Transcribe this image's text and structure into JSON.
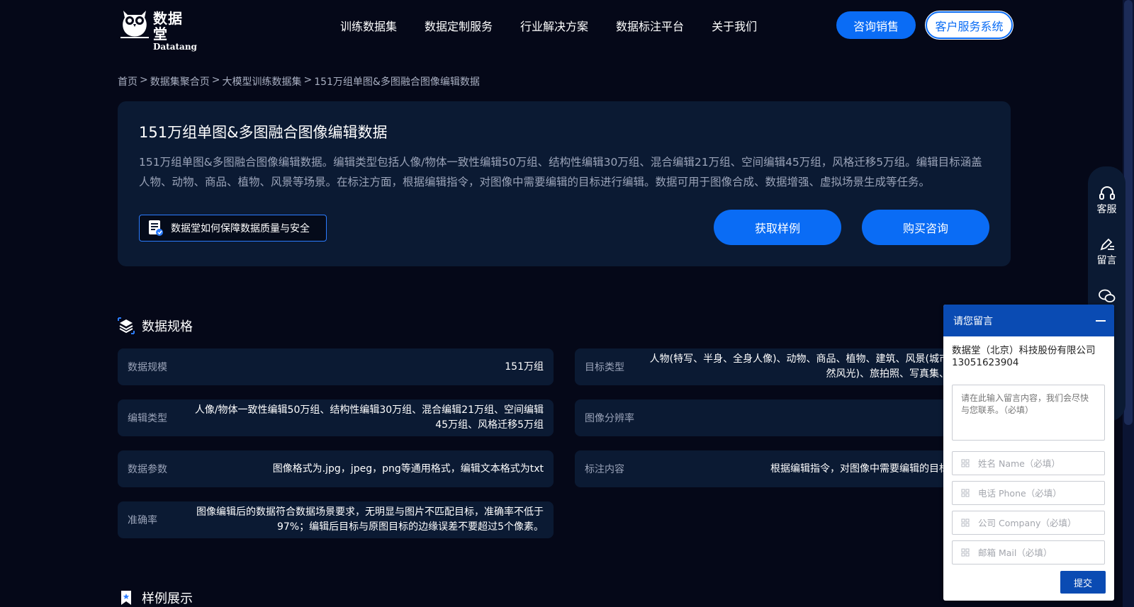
{
  "brand": {
    "name_cn": "数据堂",
    "name_en": "Datatang"
  },
  "nav": [
    "训练数据集",
    "数据定制服务",
    "行业解决方案",
    "数据标注平台",
    "关于我们"
  ],
  "header_buttons": {
    "sales": "咨询销售",
    "service": "客户服务系统"
  },
  "breadcrumb": [
    "首页",
    "数据集聚合页",
    "大模型训练数据集",
    "151万组单图&多图融合图像编辑数据"
  ],
  "breadcrumb_sep": ">",
  "hero": {
    "title": "151万组单图&多图融合图像编辑数据",
    "description": "151万组单图&多图融合图像编辑数据。编辑类型包括人像/物体一致性编辑50万组、结构性编辑30万组、混合编辑21万组、空间编辑45万组，风格迁移5万组。编辑目标涵盖人物、动物、商品、植物、风景等场景。在标注方面，根据编辑指令，对图像中需要编辑的目标进行编辑。数据可用于图像合成、数据增强、虚拟场景生成等任务。",
    "quality_label": "数据堂如何保障数据质量与安全",
    "sample_button": "获取样例",
    "buy_button": "购买咨询"
  },
  "spec_section": {
    "title": "数据规格"
  },
  "specs": [
    {
      "label": "数据规模",
      "value": "151万组"
    },
    {
      "label": "目标类型",
      "value": "人物(特写、半身、全身人像)、动物、商品、植物、建筑、风景(城市、自然风光)、旅拍照、写真集、家居"
    },
    {
      "label": "编辑类型",
      "value": "人像/物体一致性编辑50万组、结构性编辑30万组、混合编辑21万组、空间编辑45万组、风格迁移5万组"
    },
    {
      "label": "图像分辨率",
      "value": ""
    },
    {
      "label": "数据参数",
      "value": "图像格式为.jpg，jpeg，png等通用格式，编辑文本格式为txt"
    },
    {
      "label": "标注内容",
      "value": "根据编辑指令，对图像中需要编辑的目标进行"
    },
    {
      "label": "准确率",
      "value": "图像编辑后的数据符合数据场景要求，无明显与图片不匹配目标，准确率不低于97%；编辑后目标与原图目标的边缘误差不要超过5个像素。"
    }
  ],
  "sample_section": {
    "title": "样例展示"
  },
  "float_bar": {
    "service": "客服",
    "message": "留言"
  },
  "message_panel": {
    "title": "请您留言",
    "company": "数据堂（北京）科技股份有限公司",
    "phone": "13051623904",
    "textarea_placeholder": "请在此输入留言内容，我们会尽快与您联系。（必填）",
    "name_placeholder": "姓名 Name（必填）",
    "phone_placeholder": "电话 Phone（必填）",
    "company_placeholder": "公司 Company（必填）",
    "mail_placeholder": "邮箱 Mail（必填）",
    "submit": "提交"
  },
  "colors": {
    "background": "#050818",
    "card": "#0b1a33",
    "accent": "#0a6cf5",
    "panel_header": "#0a4bb3"
  }
}
